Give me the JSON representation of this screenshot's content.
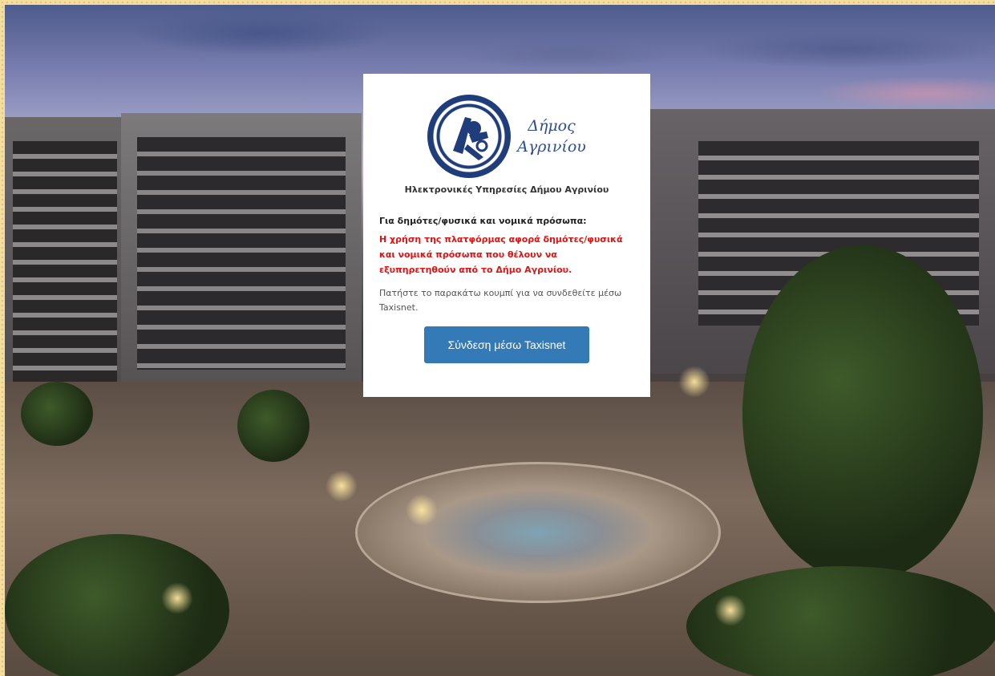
{
  "card": {
    "logo_line1": "Δήμος",
    "logo_line2": "Αγρινίου",
    "subtitle": "Ηλεκτρονικές Υπηρεσίες Δήμου Αγρινίου",
    "section_title": "Για δημότες/φυσικά και νομικά πρόσωπα:",
    "warning": "Η χρήση της πλατφόρμας αφορά δημότες/φυσικά και νομικά πρόσωπα που θέλουν να εξυπηρετηθούν από το Δήμο Αγρινίου.",
    "info": "Πατήστε το παρακάτω κουμπί για να συνδεθείτε μέσω Taxisnet.",
    "login_button": "Σύνδεση μέσω Taxisnet"
  },
  "colors": {
    "button": "#337ab7",
    "warning": "#e01212",
    "logo_text": "#2f4e8f"
  }
}
